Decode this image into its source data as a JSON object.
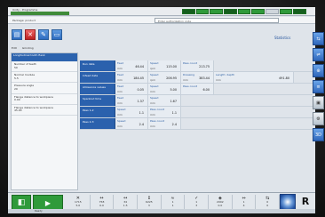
{
  "window": {
    "title": "Unity - Programma",
    "message": "User authorization code"
  },
  "pathbar": {
    "left_text": "Package: product",
    "field_text": "Enter authorization code"
  },
  "toolbar": {
    "statistics_label": "Statistics"
  },
  "tabs": [
    "Edit",
    "Grinding"
  ],
  "left_panel": {
    "header": "Longitudinal tooth flank",
    "rows": [
      {
        "label": "Number of teeth",
        "value": "50"
      },
      {
        "label": "Normal module",
        "value": "5.5"
      },
      {
        "label": "Pressure angle",
        "value": "20"
      },
      {
        "label": "Flange distance to workpiece",
        "value": "0.00"
      },
      {
        "label": "Flange distance to workpiece",
        "value": "45.00"
      }
    ]
  },
  "grid": [
    {
      "cat": "Run data",
      "cells": [
        {
          "lab": "Feed",
          "unit": "mm",
          "val": "46.44"
        },
        {
          "lab": "Speed",
          "unit": "rpm",
          "val": "115.00"
        },
        {
          "lab": "Pass count",
          "unit": "",
          "val": "213.75"
        }
      ]
    },
    {
      "cat": "Infeed data",
      "cells": [
        {
          "lab": "Feed",
          "unit": "mm",
          "val": "184.45"
        },
        {
          "lab": "Speed",
          "unit": "rpm",
          "val": "206.95"
        },
        {
          "lab": "Dressing",
          "unit": "mm",
          "val": "383.44"
        },
        {
          "lab": "Length: depth",
          "unit": "mm",
          "val": "491.80"
        }
      ]
    },
    {
      "cat": "Allowance values",
      "cells": [
        {
          "lab": "Feed",
          "unit": "mm",
          "val": "0.05"
        },
        {
          "lab": "Speed",
          "unit": "mm",
          "val": "5.00"
        },
        {
          "lab": "Pass count",
          "unit": "",
          "val": "6.00"
        }
      ]
    },
    {
      "cat": "Sparkout time",
      "cells": [
        {
          "lab": "Feed",
          "unit": "mm",
          "val": "1.37"
        },
        {
          "lab": "Speed",
          "unit": "mm",
          "val": "1.67"
        }
      ]
    },
    {
      "cat": "Pass 1-2",
      "cells": [
        {
          "lab": "Speed",
          "unit": "mm",
          "val": "1.1"
        },
        {
          "lab": "Pass count",
          "unit": "mm",
          "val": "1.1"
        }
      ]
    },
    {
      "cat": "Pass 2-3",
      "cells": [
        {
          "lab": "Speed",
          "unit": "mm",
          "val": "2.4"
        },
        {
          "lab": "Pass count",
          "unit": "mm",
          "val": "2.4"
        }
      ]
    }
  ],
  "bottom": {
    "big1": "",
    "big2": "",
    "cells": [
      {
        "sym": "✕",
        "v1": "1715",
        "v2": "5.0"
      },
      {
        "sym": "↔",
        "v1": "758",
        "v2": "0.0"
      },
      {
        "sym": "↔",
        "v1": "34",
        "v2": "1.5"
      },
      {
        "sym": "↕",
        "v1": "6225",
        "v2": "3"
      },
      {
        "sym": "≈",
        "v1": "1",
        "v2": "1"
      },
      {
        "sym": "✓",
        "v1": "1",
        "v2": "3"
      },
      {
        "sym": "◈",
        "v1": "2002",
        "v2": "0.0"
      },
      {
        "sym": "⇔",
        "v1": "1",
        "v2": "4"
      },
      {
        "sym": "⇆",
        "v1": "0",
        "v2": "0"
      }
    ],
    "logo_letter": "R",
    "status": "Ready"
  },
  "right_buttons": [
    "⇆",
    "⇌",
    "⊕",
    "≡",
    "▣",
    "⚙",
    "3D"
  ],
  "colors": {
    "accent": "#2b61ad",
    "ok": "#2f9a3a"
  }
}
